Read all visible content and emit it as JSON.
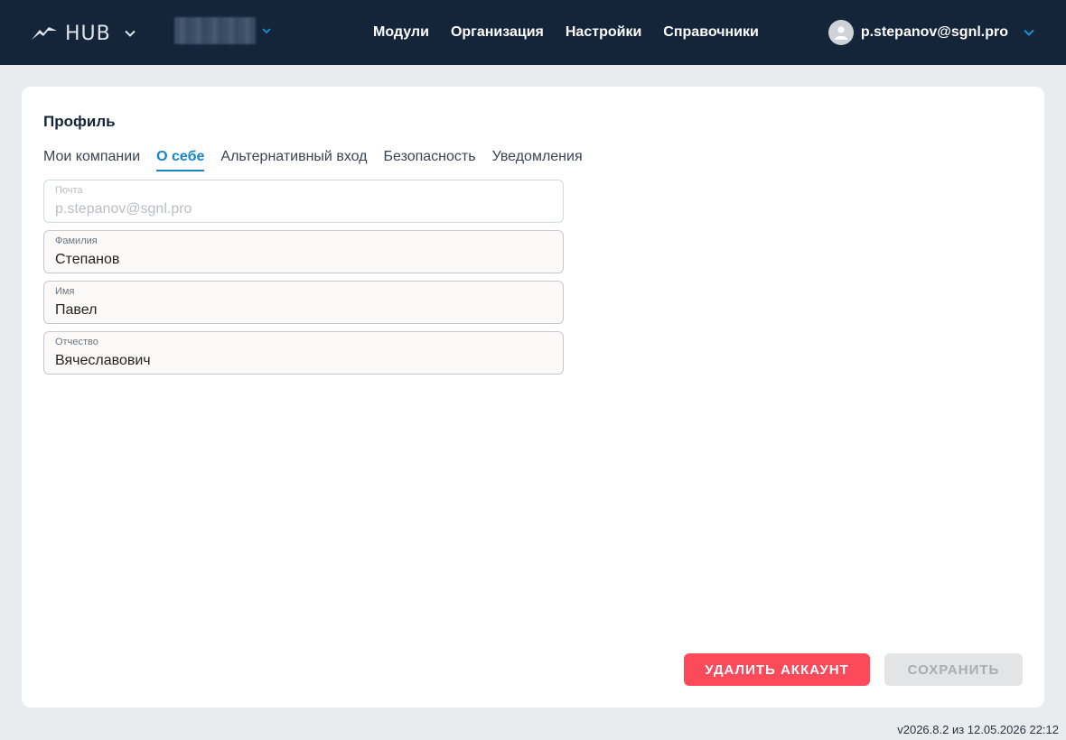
{
  "app": {
    "logo_text": "HUB",
    "colors": {
      "topbar": "#14253a",
      "accent": "#1585c6",
      "danger": "#fc4a5b",
      "disabled_bg": "#e3e4e5"
    },
    "icons": {
      "logo": "bird-logo-icon",
      "chevron": "chevron-down-icon",
      "avatar": "user-avatar-icon"
    }
  },
  "nav": {
    "items": [
      {
        "label": "Модули"
      },
      {
        "label": "Организация"
      },
      {
        "label": "Настройки"
      },
      {
        "label": "Справочники"
      }
    ]
  },
  "user": {
    "email": "p.stepanov@sgnl.pro"
  },
  "profile": {
    "title": "Профиль",
    "tabs": [
      {
        "label": "Мои компании",
        "active": false
      },
      {
        "label": "О себе",
        "active": true
      },
      {
        "label": "Альтернативный вход",
        "active": false
      },
      {
        "label": "Безопасность",
        "active": false
      },
      {
        "label": "Уведомления",
        "active": false
      }
    ],
    "fields": [
      {
        "label": "Почта",
        "value": "p.stepanov@sgnl.pro",
        "disabled": true
      },
      {
        "label": "Фамилия",
        "value": "Степанов",
        "disabled": false
      },
      {
        "label": "Имя",
        "value": "Павел",
        "disabled": false
      },
      {
        "label": "Отчество",
        "value": "Вячеславович",
        "disabled": false
      }
    ],
    "buttons": {
      "delete_label": "УДАЛИТЬ АККАУНТ",
      "save_label": "СОХРАНИТЬ"
    }
  },
  "footer": {
    "version": "v2026.8.2 из 12.05.2026 22:12"
  }
}
